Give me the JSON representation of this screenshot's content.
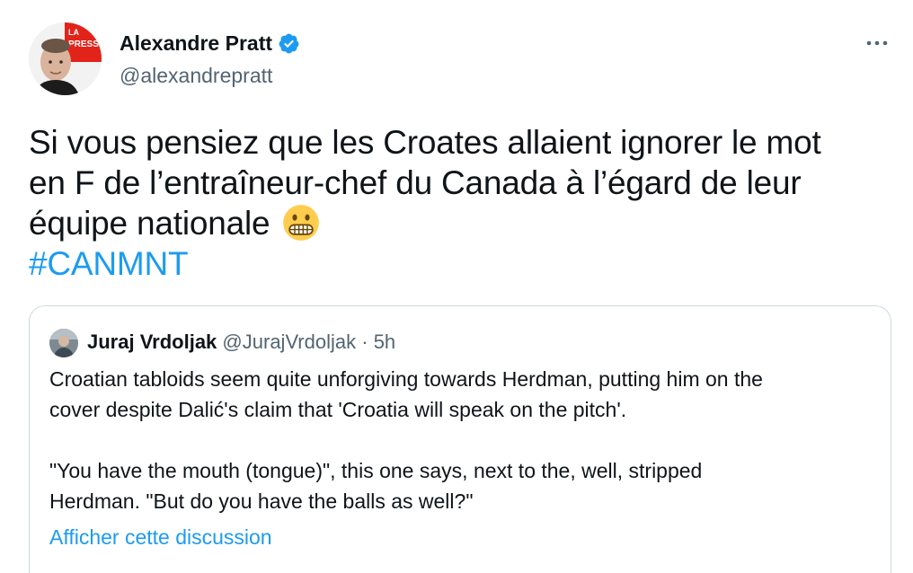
{
  "author": {
    "name": "Alexandre Pratt",
    "handle": "@alexandrepratt",
    "verified": true,
    "avatar_badge_text": "LA PRESSE"
  },
  "tweet": {
    "lines": [
      "Si vous pensiez que les Croates allaient ignorer le mot",
      "en F de l’entraîneur-chef du Canada à l’égard de leur",
      "équipe nationale"
    ],
    "emoji": "grimacing-face-emoji",
    "hashtag": "#CANMNT"
  },
  "quoted": {
    "name": "Juraj Vrdoljak",
    "handle": "@JurajVrdoljak",
    "separator": "·",
    "time": "5h",
    "paragraphs": [
      [
        "Croatian tabloids seem quite unforgiving towards Herdman, putting him on the",
        "cover despite Dalić's claim that 'Croatia will speak on the pitch'."
      ],
      [
        "\"You have the mouth (tongue)\", this one says, next to the, well, stripped",
        "Herdman. \"But do you have the balls as well?\""
      ]
    ],
    "show_thread_link": "Afficher cette discussion"
  },
  "colors": {
    "text": "#0f1419",
    "secondary": "#536471",
    "link": "#1d9bf0",
    "border": "#cfd9de",
    "brand_red": "#e2231a"
  }
}
